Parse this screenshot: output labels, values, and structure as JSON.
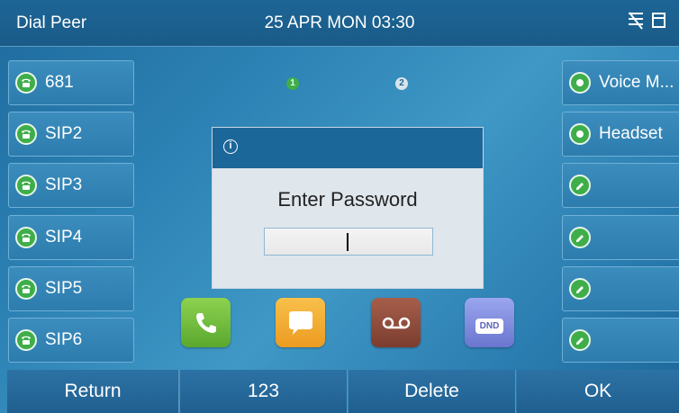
{
  "topbar": {
    "title": "Dial Peer",
    "datetime": "25 APR MON  03:30",
    "status_icons": [
      "network-off-icon",
      "dnd-lock-icon"
    ]
  },
  "left_keys": [
    {
      "label": "681",
      "icon": "phone-icon"
    },
    {
      "label": "SIP2",
      "icon": "phone-icon"
    },
    {
      "label": "SIP3",
      "icon": "phone-icon"
    },
    {
      "label": "SIP4",
      "icon": "phone-icon"
    },
    {
      "label": "SIP5",
      "icon": "phone-icon"
    },
    {
      "label": "SIP6",
      "icon": "phone-icon"
    }
  ],
  "right_keys": [
    {
      "label": "Voice M...",
      "icon": "dot-icon"
    },
    {
      "label": "Headset",
      "icon": "dot-icon"
    },
    {
      "label": "",
      "icon": "edit-icon"
    },
    {
      "label": "",
      "icon": "edit-icon"
    },
    {
      "label": "",
      "icon": "edit-icon"
    },
    {
      "label": "",
      "icon": "edit-icon"
    }
  ],
  "page_indicators": [
    "1",
    "2"
  ],
  "dialog": {
    "icon": "info-icon",
    "prompt": "Enter Password",
    "password_value": ""
  },
  "apps": [
    {
      "name": "call",
      "color": "#6cbf3a"
    },
    {
      "name": "messages",
      "color": "#f2a92d"
    },
    {
      "name": "voicemail",
      "color": "#8a4a3a"
    },
    {
      "name": "dnd",
      "color": "#7b86d8",
      "text": "DND"
    }
  ],
  "softkeys": [
    "Return",
    "123",
    "Delete",
    "OK"
  ],
  "colors": {
    "line_icon_green": "#3fae4a",
    "dialog_header": "#1c679a",
    "page_dot_active": "#3fae4a",
    "page_dot_inactive": "#d9e4ea"
  }
}
